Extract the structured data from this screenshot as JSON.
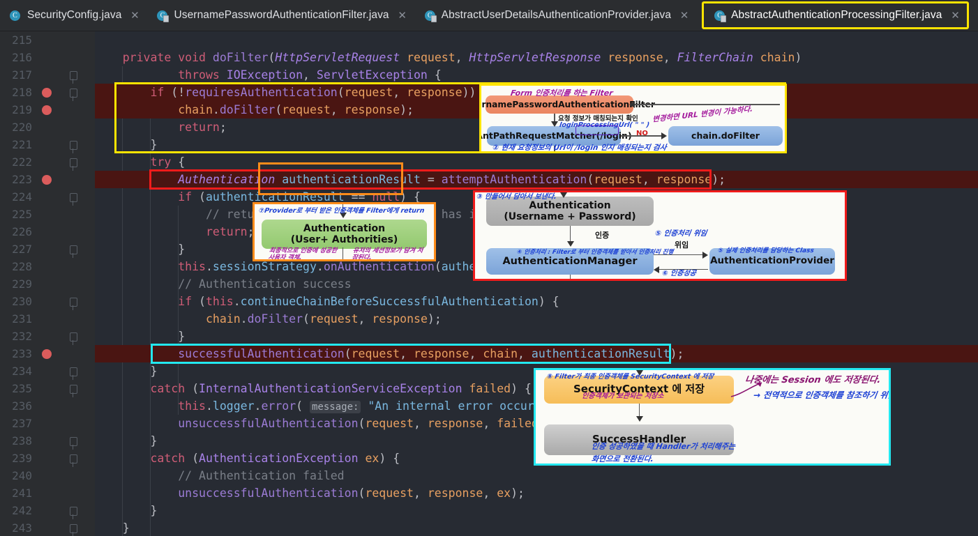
{
  "window": {
    "editor_theme_bg": "#272b33",
    "tabbar_bg": "#2b2d30",
    "highlight_yellow": "#ffe400",
    "highlight_red": "#f01b1b",
    "highlight_orange": "#ff8c1a",
    "highlight_cyan": "#23e8f0"
  },
  "tabs": [
    {
      "label": "SecurityConfig.java",
      "icon": "java-class-icon",
      "close": "✕",
      "active": false,
      "highlighted": false
    },
    {
      "label": "UsernamePasswordAuthenticationFilter.java",
      "icon": "java-class-icon",
      "close": "✕",
      "active": false,
      "highlighted": false
    },
    {
      "label": "AbstractUserDetailsAuthenticationProvider.java",
      "icon": "java-class-icon",
      "close": "✕",
      "active": false,
      "highlighted": false
    },
    {
      "label": "AbstractAuthenticationProcessingFilter.java",
      "icon": "java-class-icon",
      "close": "✕",
      "active": true,
      "highlighted": true
    }
  ],
  "editor": {
    "first_line": 215,
    "last_line": 243,
    "lines": [
      {
        "n": "215",
        "text": "",
        "breakpoint": false,
        "executing": false,
        "fold": false
      },
      {
        "n": "216",
        "text": "private void doFilter(HttpServletRequest request, HttpServletResponse response, FilterChain chain)",
        "breakpoint": false,
        "executing": false,
        "fold": false
      },
      {
        "n": "217",
        "text": "throws IOException, ServletException {",
        "breakpoint": false,
        "executing": false,
        "fold": true
      },
      {
        "n": "218",
        "text": "if (!requiresAuthentication(request, response)) {",
        "breakpoint": true,
        "executing": true,
        "fold": true
      },
      {
        "n": "219",
        "text": "chain.doFilter(request, response);",
        "breakpoint": true,
        "executing": true,
        "fold": false
      },
      {
        "n": "220",
        "text": "return;",
        "breakpoint": false,
        "executing": false,
        "fold": false
      },
      {
        "n": "221",
        "text": "}",
        "breakpoint": false,
        "executing": false,
        "fold": true
      },
      {
        "n": "222",
        "text": "try {",
        "breakpoint": false,
        "executing": false,
        "fold": true
      },
      {
        "n": "223",
        "text": "Authentication authenticationResult = attemptAuthentication(request, response);",
        "breakpoint": true,
        "executing": true,
        "fold": false
      },
      {
        "n": "224",
        "text": "if (authenticationResult == null) {",
        "breakpoint": false,
        "executing": false,
        "fold": true
      },
      {
        "n": "225",
        "text": "// return immediately as subclass has indicated that it hasn't completed",
        "breakpoint": false,
        "executing": false,
        "fold": false
      },
      {
        "n": "226",
        "text": "return;",
        "breakpoint": false,
        "executing": false,
        "fold": false
      },
      {
        "n": "227",
        "text": "}",
        "breakpoint": false,
        "executing": false,
        "fold": true
      },
      {
        "n": "228",
        "text": "this.sessionStrategy.onAuthentication(authenticationResult, request, response);",
        "breakpoint": false,
        "executing": false,
        "fold": false
      },
      {
        "n": "229",
        "text": "// Authentication success",
        "breakpoint": false,
        "executing": false,
        "fold": false
      },
      {
        "n": "230",
        "text": "if (this.continueChainBeforeSuccessfulAuthentication) {",
        "breakpoint": false,
        "executing": false,
        "fold": true
      },
      {
        "n": "231",
        "text": "chain.doFilter(request, response);",
        "breakpoint": false,
        "executing": false,
        "fold": false
      },
      {
        "n": "232",
        "text": "}",
        "breakpoint": false,
        "executing": false,
        "fold": true
      },
      {
        "n": "233",
        "text": "successfulAuthentication(request, response, chain, authenticationResult);",
        "breakpoint": true,
        "executing": true,
        "fold": false
      },
      {
        "n": "234",
        "text": "}",
        "breakpoint": false,
        "executing": false,
        "fold": true
      },
      {
        "n": "235",
        "text": "catch (InternalAuthenticationServiceException failed) {",
        "breakpoint": false,
        "executing": false,
        "fold": true
      },
      {
        "n": "236",
        "text": "this.logger.error( message: \"An internal error occurred while trying to authenticate the user.\", failed);",
        "breakpoint": false,
        "executing": false,
        "fold": false
      },
      {
        "n": "237",
        "text": "unsuccessfulAuthentication(request, response, failed);",
        "breakpoint": false,
        "executing": false,
        "fold": false
      },
      {
        "n": "238",
        "text": "}",
        "breakpoint": false,
        "executing": false,
        "fold": true
      },
      {
        "n": "239",
        "text": "catch (AuthenticationException ex) {",
        "breakpoint": false,
        "executing": false,
        "fold": true
      },
      {
        "n": "240",
        "text": "// Authentication failed",
        "breakpoint": false,
        "executing": false,
        "fold": false
      },
      {
        "n": "241",
        "text": "unsuccessfulAuthentication(request, response, ex);",
        "breakpoint": false,
        "executing": false,
        "fold": false
      },
      {
        "n": "242",
        "text": "}",
        "breakpoint": false,
        "executing": false,
        "fold": true
      },
      {
        "n": "243",
        "text": "}",
        "breakpoint": false,
        "executing": false,
        "fold": true
      }
    ],
    "inlay_hint_message": "message:",
    "string_literal": "\"An internal error occurred"
  },
  "code_highlights": [
    {
      "name": "requires-authentication-block",
      "color": "#ffe400",
      "lines": "218-221"
    },
    {
      "name": "attempt-authentication-line",
      "color": "#f01b1b",
      "lines": "223"
    },
    {
      "name": "authentication-result-variable",
      "color": "#ff8c1a",
      "lines": "223"
    },
    {
      "name": "successful-authentication-call",
      "color": "#23e8f0",
      "lines": "233"
    }
  ],
  "diagrams": {
    "filter_flow": {
      "border_color": "#ffe400",
      "nodes": [
        {
          "id": "upaf",
          "label": "UsernamePasswordAuthenticationFilter",
          "color": "salmon"
        },
        {
          "id": "matcher",
          "label": "AntPathRequestMatcher",
          "label2": "(/login)",
          "color": "blue"
        },
        {
          "id": "chain",
          "label": "chain.doFilter",
          "color": "blue"
        }
      ],
      "edge_labels": [
        "NO",
        "요청 정보가 매칭되는지 확인"
      ],
      "annotations": [
        {
          "text": "Form 인증처리를 하는 Filter",
          "color": "#a3189c"
        },
        {
          "text": "변경하면 URL 변경이 가능하다.",
          "color": "#a3189c"
        },
        {
          "text": "loginProcessingUrl( \" \" )",
          "color": "#1b3fd4"
        },
        {
          "text": "② 현재 요청정보의 Url이 /login 인지 매칭되는지 검사",
          "color": "#1b3fd4"
        }
      ]
    },
    "authentication_result": {
      "border_color": "#ff8c1a",
      "nodes": [
        {
          "id": "auth",
          "label": "Authentication",
          "label2": "(User+ Authorities)",
          "color": "green"
        }
      ],
      "annotations": [
        {
          "text": "⑦Provider로 부터 받은 인증객체를 Filter에게 return",
          "color": "#1b3fd4"
        },
        {
          "text": "최종적으로 인증에 성공한 사용자 객체.",
          "color": "#a3189c"
        },
        {
          "text": "유저의 세션정보가 담겨 저장된다.",
          "color": "#a3189c"
        }
      ]
    },
    "authentication_manager": {
      "border_color": "#f01b1b",
      "nodes": [
        {
          "id": "auth",
          "label": "Authentication",
          "label2": "(Username + Password)",
          "color": "grey"
        },
        {
          "id": "mgr",
          "label": "AuthenticationManager",
          "color": "blue"
        },
        {
          "id": "prov",
          "label": "AuthenticationProvider",
          "color": "blue"
        }
      ],
      "edge_labels": [
        "인증",
        "위임"
      ],
      "annotations": [
        {
          "text": "③ 만들어서 담아서 보낸다.",
          "color": "#1b3fd4"
        },
        {
          "text": "④ 인증처리 : Filter로 부터 인증객체를 받아서 인증처리 진행",
          "color": "#1b3fd4"
        },
        {
          "text": "⑤ 인증처리 위임",
          "color": "#1b3fd4"
        },
        {
          "text": "⑤ 실제 인증처리를 담당하는 Class",
          "color": "#1b3fd4"
        },
        {
          "text": "⑥ 인증성공",
          "color": "#1b3fd4"
        }
      ]
    },
    "security_context": {
      "border_color": "#23e8f0",
      "nodes": [
        {
          "id": "ctx",
          "label": "SecurityContext 에 저장",
          "color": "orange"
        },
        {
          "id": "handler",
          "label": "SuccessHandler",
          "color": "grey2"
        }
      ],
      "annotations": [
        {
          "text": "⑧ Filter가 최종 인증객체를 SecurityContext 에 저장",
          "color": "#1b3fd4"
        },
        {
          "text": "인증객체가 보관되는 저장소",
          "color": "#a3189c"
        },
        {
          "text": "나중에는 Session 에도 저장된다.",
          "color": "#a3189c"
        },
        {
          "text": "→ 전역적으로 인증객체를 참조하기 위함.",
          "color": "#1b3fd4"
        },
        {
          "text": "인증 성공하였을 때 Handler가 처리해주는",
          "color": "#1b3fd4"
        },
        {
          "text": "화면으로 전환된다.",
          "color": "#1b3fd4"
        }
      ]
    }
  }
}
